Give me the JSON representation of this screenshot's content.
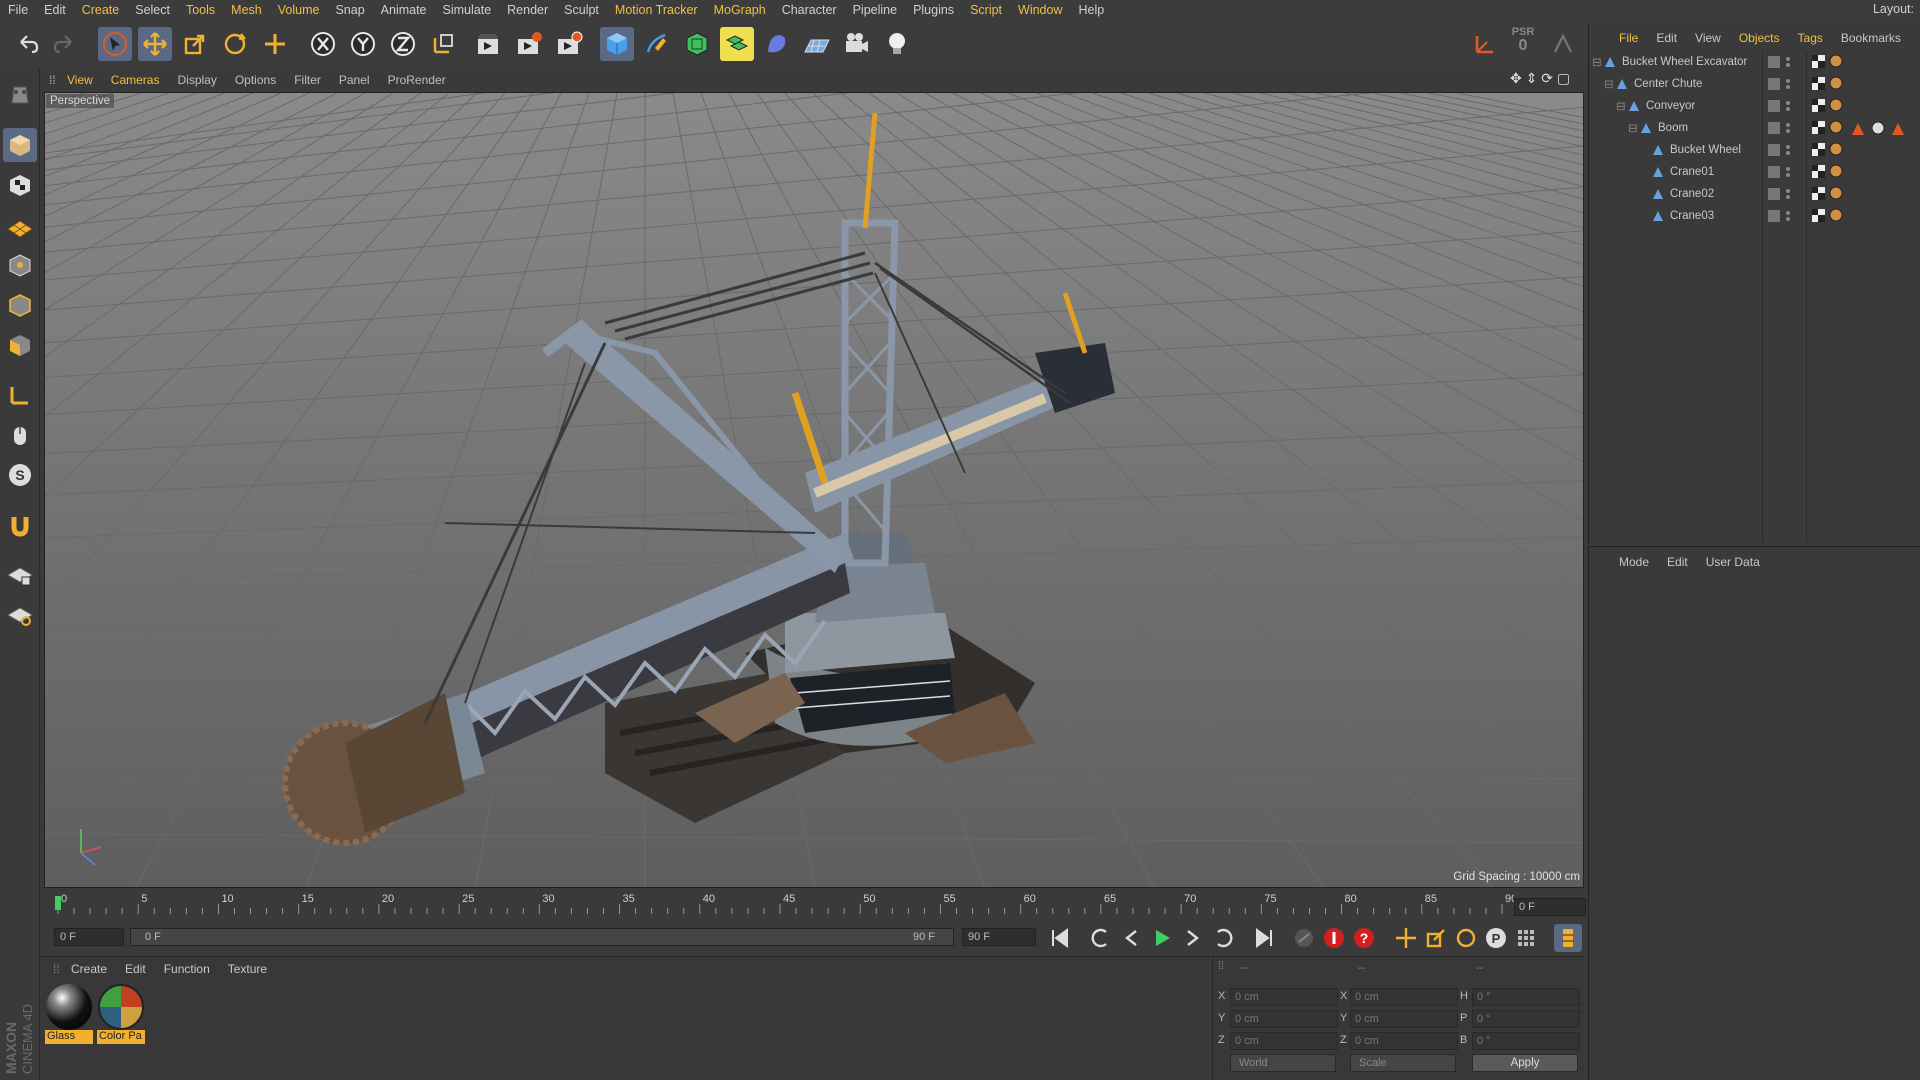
{
  "menubar": {
    "items": [
      "File",
      "Edit",
      "Create",
      "Select",
      "Tools",
      "Mesh",
      "Volume",
      "Snap",
      "Animate",
      "Simulate",
      "Render",
      "Sculpt",
      "Motion Tracker",
      "MoGraph",
      "Character",
      "Pipeline",
      "Plugins",
      "Script",
      "Window",
      "Help"
    ],
    "layout_label": "Layout:"
  },
  "toolbar": {
    "icons": [
      "undo-icon",
      "redo-icon",
      "select-arrow-icon",
      "move-icon",
      "scale-icon",
      "rotate-icon",
      "add-icon",
      "x-axis-icon",
      "y-axis-icon",
      "z-axis-icon",
      "world-coord-icon",
      "render-view-icon",
      "render-picture-viewer-icon",
      "edit-render-settings-icon",
      "cube-icon",
      "pen-icon",
      "subdivision-icon",
      "array-icon",
      "deformer-icon",
      "floor-icon",
      "camera-icon",
      "light-icon"
    ],
    "psr_label": "PSR",
    "psr_value": "0"
  },
  "viewport": {
    "menu": [
      "View",
      "Cameras",
      "Display",
      "Options",
      "Filter",
      "Panel",
      "ProRender"
    ],
    "label": "Perspective",
    "grid_spacing": "Grid Spacing : 10000 cm"
  },
  "timeline": {
    "ticks": [
      "0",
      "5",
      "10",
      "15",
      "20",
      "25",
      "30",
      "35",
      "40",
      "45",
      "50",
      "55",
      "60",
      "65",
      "70",
      "75",
      "80",
      "85",
      "90"
    ],
    "current_frame_display": "0 F"
  },
  "transport": {
    "start_field": "0 F",
    "range_left": "0 F",
    "range_right": "90 F",
    "end_field": "90 F"
  },
  "materials": {
    "menu": [
      "Create",
      "Edit",
      "Function",
      "Texture"
    ],
    "items": [
      {
        "label": "Glass"
      },
      {
        "label": "Color Pa"
      }
    ]
  },
  "coordinates": {
    "headers": [
      "--",
      "--",
      "--"
    ],
    "rows": [
      {
        "axis1": "X",
        "pos": "0 cm",
        "axis2": "X",
        "size": "0 cm",
        "axis3": "H",
        "rot": "0 °"
      },
      {
        "axis1": "Y",
        "pos": "0 cm",
        "axis2": "Y",
        "size": "0 cm",
        "axis3": "P",
        "rot": "0 °"
      },
      {
        "axis1": "Z",
        "pos": "0 cm",
        "axis2": "Z",
        "size": "0 cm",
        "axis3": "B",
        "rot": "0 °"
      }
    ],
    "mode_dropdown": "World",
    "scale_dropdown": "Scale",
    "apply_label": "Apply"
  },
  "object_manager": {
    "menu": [
      "File",
      "Edit",
      "View",
      "Objects",
      "Tags",
      "Bookmarks"
    ],
    "objects": [
      {
        "name": "Bucket Wheel Excavator"
      },
      {
        "name": "Center Chute"
      },
      {
        "name": "Conveyor"
      },
      {
        "name": "Boom"
      },
      {
        "name": "Bucket Wheel"
      },
      {
        "name": "Crane01"
      },
      {
        "name": "Crane02"
      },
      {
        "name": "Crane03"
      }
    ]
  },
  "attribute_manager": {
    "menu": [
      "Mode",
      "Edit",
      "User Data"
    ]
  },
  "branding": {
    "logo": "MAXON CINEMA 4D"
  },
  "colors": {
    "accent": "#f0c040",
    "active_tool": "#5a6a85",
    "background": "#3a3a3a",
    "material_label": "#f0b030"
  }
}
